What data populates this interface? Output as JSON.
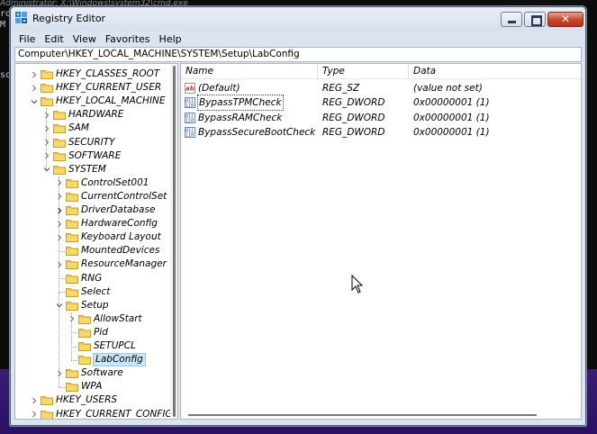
{
  "background": {
    "cmd_title": "Administrator: X:\\Windows\\system32\\cmd.exe",
    "cmd_fragments": [
      "ro",
      "M",
      "",
      "so"
    ]
  },
  "window": {
    "title": "Registry Editor"
  },
  "menu": [
    "File",
    "Edit",
    "View",
    "Favorites",
    "Help"
  ],
  "address": "Computer\\HKEY_LOCAL_MACHINE\\SYSTEM\\Setup\\LabConfig",
  "tree": [
    {
      "label": "HKEY_CLASSES_ROOT",
      "twisty": "collapsed",
      "level": 0
    },
    {
      "label": "HKEY_CURRENT_USER",
      "twisty": "collapsed",
      "level": 0
    },
    {
      "label": "HKEY_LOCAL_MACHINE",
      "twisty": "expanded",
      "level": 0
    },
    {
      "label": "HARDWARE",
      "twisty": "collapsed",
      "level": 1
    },
    {
      "label": "SAM",
      "twisty": "collapsed",
      "level": 1
    },
    {
      "label": "SECURITY",
      "twisty": "collapsed",
      "level": 1
    },
    {
      "label": "SOFTWARE",
      "twisty": "collapsed",
      "level": 1
    },
    {
      "label": "SYSTEM",
      "twisty": "expanded",
      "level": 1
    },
    {
      "label": "ControlSet001",
      "twisty": "collapsed",
      "level": 2
    },
    {
      "label": "CurrentControlSet",
      "twisty": "collapsed",
      "level": 2
    },
    {
      "label": "DriverDatabase",
      "twisty": "collapsed-dark",
      "level": 2
    },
    {
      "label": "HardwareConfig",
      "twisty": "collapsed",
      "level": 2
    },
    {
      "label": "Keyboard Layout",
      "twisty": "collapsed",
      "level": 2
    },
    {
      "label": "MountedDevices",
      "twisty": "none",
      "level": 2
    },
    {
      "label": "ResourceManager",
      "twisty": "collapsed",
      "level": 2
    },
    {
      "label": "RNG",
      "twisty": "none",
      "level": 2
    },
    {
      "label": "Select",
      "twisty": "none",
      "level": 2
    },
    {
      "label": "Setup",
      "twisty": "expanded",
      "level": 2
    },
    {
      "label": "AllowStart",
      "twisty": "collapsed",
      "level": 3
    },
    {
      "label": "Pid",
      "twisty": "none",
      "level": 3
    },
    {
      "label": "SETUPCL",
      "twisty": "none",
      "level": 3
    },
    {
      "label": "LabConfig",
      "twisty": "none",
      "level": 3,
      "selected": true
    },
    {
      "label": "Software",
      "twisty": "collapsed",
      "level": 2
    },
    {
      "label": "WPA",
      "twisty": "none",
      "level": 2
    },
    {
      "label": "HKEY_USERS",
      "twisty": "collapsed",
      "level": 0
    },
    {
      "label": "HKEY_CURRENT_CONFIG",
      "twisty": "collapsed",
      "level": 0
    }
  ],
  "list": {
    "headers": {
      "name": "Name",
      "type": "Type",
      "data": "Data"
    },
    "rows": [
      {
        "name": "(Default)",
        "type": "REG_SZ",
        "data": "(value not set)",
        "icon": "string-value-icon"
      },
      {
        "name": "BypassTPMCheck",
        "type": "REG_DWORD",
        "data": "0x00000001 (1)",
        "icon": "binary-value-icon",
        "focused": true
      },
      {
        "name": "BypassRAMCheck",
        "type": "REG_DWORD",
        "data": "0x00000001 (1)",
        "icon": "binary-value-icon"
      },
      {
        "name": "BypassSecureBootCheck",
        "type": "REG_DWORD",
        "data": "0x00000001 (1)",
        "icon": "binary-value-icon"
      }
    ]
  },
  "colors": {
    "folder": "#f2c94c",
    "selection": "#cce4f7",
    "close_button": "#c8432c"
  }
}
